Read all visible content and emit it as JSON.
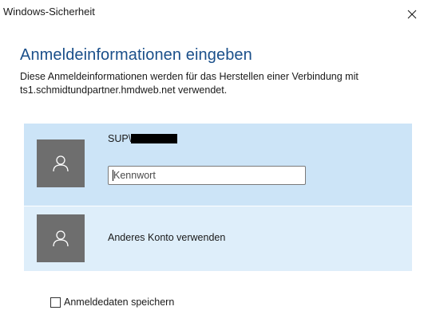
{
  "window": {
    "title": "Windows-Sicherheit",
    "close_glyph": "✕"
  },
  "heading": "Anmeldeinformationen eingeben",
  "description": "Diese Anmeldeinformationen werden für das Herstellen einer Verbindung mit ts1.schmidtundpartner.hmdweb.net verwendet.",
  "accounts": {
    "current": {
      "username_prefix": "SUP\\",
      "username_redacted": true,
      "avatar_icon": "user-icon",
      "password_placeholder": "Kennwort",
      "password_value": ""
    },
    "other": {
      "label": "Anderes Konto verwenden",
      "avatar_icon": "user-icon"
    }
  },
  "remember": {
    "label": "Anmeldedaten speichern",
    "checked": false
  },
  "colors": {
    "heading": "#1a4f8a",
    "tile_selected": "#cce4f7",
    "tile_other": "#deeefa",
    "avatar_bg": "#6e6e6e"
  }
}
